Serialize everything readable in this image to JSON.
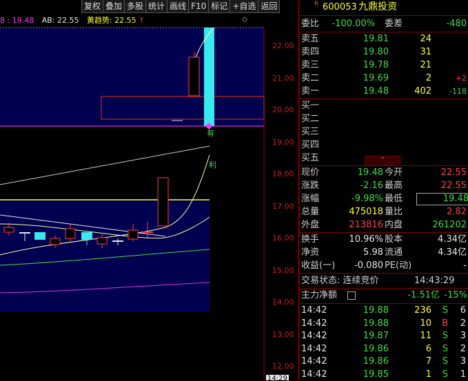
{
  "toolbar": [
    "复权",
    "叠加",
    "多股",
    "统计",
    "画线",
    "F10",
    "标记",
    "+自选",
    "返回"
  ],
  "legend": {
    "item1_value": "8 : 19.48",
    "item2": "AB: 22.55",
    "item3": "黄趋势: 22.55"
  },
  "chart": {
    "price_axis": [
      "22.00",
      "21.00",
      "20.00",
      "19.00",
      "18.00",
      "17.00",
      "16.00",
      "15.00",
      "14.00",
      "13.00",
      "12.00"
    ],
    "signal_you": "有",
    "signal_li": "利",
    "diamond": "◇",
    "bottom_time": "14:29"
  },
  "stock": {
    "badge": "R",
    "code": "600053",
    "name": "九鼎投资"
  },
  "commit": {
    "ratio_label": "委比",
    "ratio": "-100.00%",
    "diff_label": "委差",
    "diff": "-480"
  },
  "asks": [
    {
      "label": "卖五",
      "price": "19.81",
      "vol": "24",
      "chg": ""
    },
    {
      "label": "卖四",
      "price": "19.80",
      "vol": "31",
      "chg": ""
    },
    {
      "label": "卖三",
      "price": "19.78",
      "vol": "21",
      "chg": ""
    },
    {
      "label": "卖二",
      "price": "19.69",
      "vol": "2",
      "chg": "+2"
    },
    {
      "label": "卖一",
      "price": "19.48",
      "vol": "402",
      "chg": "-118"
    }
  ],
  "bids": [
    "买一",
    "买二",
    "买三",
    "买四",
    "买五"
  ],
  "quote": [
    {
      "l1": "现价",
      "v1": "19.48",
      "c1": "green",
      "l2": "今开",
      "v2": "22.55",
      "c2": "red"
    },
    {
      "l1": "涨跌",
      "v1": "-2.16",
      "c1": "green",
      "l2": "最高",
      "v2": "22.55",
      "c2": "red"
    },
    {
      "l1": "涨幅",
      "v1": "-9.98%",
      "c1": "green",
      "l2": "最低",
      "v2": "19.48",
      "c2": "green"
    },
    {
      "l1": "总量",
      "v1": "475018",
      "c1": "yel",
      "l2": "量比",
      "v2": "2.82",
      "c2": "red"
    },
    {
      "l1": "外盘",
      "v1": "213816",
      "c1": "red",
      "l2": "内盘",
      "v2": "261202",
      "c2": "green"
    }
  ],
  "fin": [
    {
      "l1": "换手",
      "v1": "10.96%",
      "l2": "股本",
      "v2": "4.34亿"
    },
    {
      "l1": "净资",
      "v1": "5.98",
      "l2": "流通",
      "v2": "4.34亿"
    },
    {
      "l1": "收益(一)",
      "v1": "-0.080",
      "l2": "PE(动)",
      "v2": "-"
    }
  ],
  "status": {
    "label": "交易状态: 连续竞价",
    "time": "14:43:29"
  },
  "capital": {
    "label": "主力净额",
    "value": "-1.51亿",
    "pct": "-15%"
  },
  "ticks": [
    {
      "t": "14:42",
      "p": "19.88",
      "v": "236",
      "s": "S",
      "n": "6"
    },
    {
      "t": "14:42",
      "p": "19.88",
      "v": "10",
      "s": "B",
      "n": "2"
    },
    {
      "t": "14:42",
      "p": "19.87",
      "v": "11",
      "s": "S",
      "n": "3"
    },
    {
      "t": "14:42",
      "p": "19.86",
      "v": "6",
      "s": "S",
      "n": "2"
    },
    {
      "t": "14:42",
      "p": "19.86",
      "v": "7",
      "s": "S",
      "n": "3"
    },
    {
      "t": "14:42",
      "p": "19.85",
      "v": "1",
      "s": "S",
      "n": "1"
    }
  ],
  "colors": {
    "up": "#ff4040",
    "down": "#3fde3f",
    "volume": "#ffff33",
    "accent": "#3ae8f0",
    "buy": "#ff3030",
    "sell": "#3fde3f"
  }
}
